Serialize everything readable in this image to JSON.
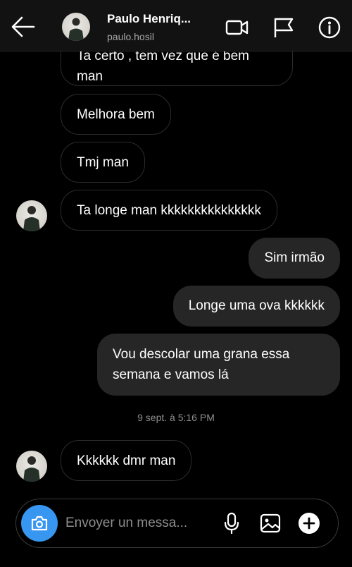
{
  "header": {
    "name": "Paulo Henriq...",
    "username": "paulo.hosil"
  },
  "messages": [
    {
      "id": "m0",
      "direction": "incoming",
      "text": "Ta certo , tem vez que é bem man",
      "visible_text": "man"
    },
    {
      "id": "m1",
      "direction": "incoming",
      "text": "Melhora bem"
    },
    {
      "id": "m2",
      "direction": "incoming",
      "text": "Tmj man"
    },
    {
      "id": "m3",
      "direction": "incoming",
      "text": "Ta longe man kkkkkkkkkkkkkkk"
    },
    {
      "id": "m4",
      "direction": "outgoing",
      "text": "Sim irmão"
    },
    {
      "id": "m5",
      "direction": "outgoing",
      "text": "Longe uma ova kkkkkk"
    },
    {
      "id": "m6",
      "direction": "outgoing",
      "text": "Vou descolar uma grana essa semana e vamos lá"
    },
    {
      "id": "m7",
      "direction": "incoming",
      "text": "Kkkkkk dmr man"
    }
  ],
  "timestamp": "9 sept. à 5:16 PM",
  "composer": {
    "placeholder": "Envoyer un messa..."
  },
  "icons": {
    "back": "arrow-left",
    "video": "video-camera",
    "flag": "flag",
    "info": "info-circle",
    "camera": "camera",
    "mic": "microphone",
    "gallery": "image",
    "add": "plus-circle"
  },
  "colors": {
    "background": "#000000",
    "bubble": "#262626",
    "accent": "#3797f0",
    "secondary_text": "#a8a8a8"
  }
}
